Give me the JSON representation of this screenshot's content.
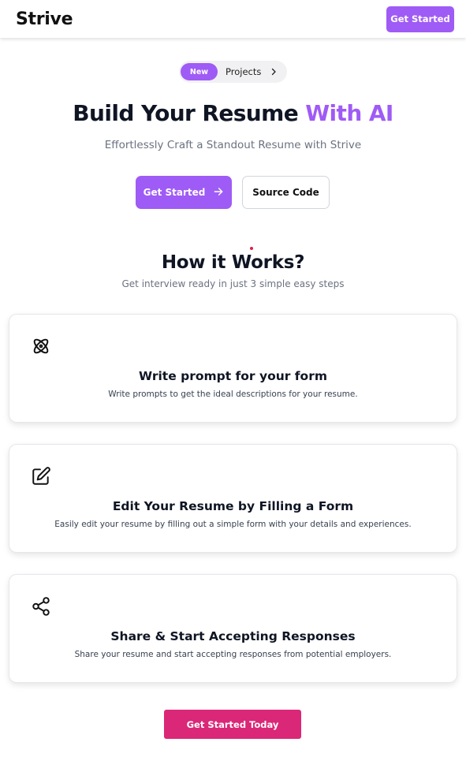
{
  "header": {
    "logo": "Strive",
    "cta_label": "Get Started"
  },
  "announcement": {
    "badge": "New",
    "label": "Projects",
    "icon": "chevron-right-icon"
  },
  "hero": {
    "title_main": "Build Your Resume",
    "title_accent": "With AI",
    "subtitle": "Effortlessly Craft a Standout Resume with Strive",
    "primary_label": "Get Started",
    "primary_icon": "arrow-right-icon",
    "secondary_label": "Source Code"
  },
  "how": {
    "title": "How it Works?",
    "subtitle": "Get interview ready in just 3 simple easy steps",
    "steps": [
      {
        "icon": "atom-icon",
        "title": "Write prompt for your form",
        "description": "Write prompts to get the ideal descriptions for your resume."
      },
      {
        "icon": "edit-icon",
        "title": "Edit Your Resume by Filling a Form",
        "description": "Easily edit your resume by filling out a simple form with your details and experiences."
      },
      {
        "icon": "share-icon",
        "title": "Share & Start Accepting Responses",
        "description": "Share your resume and start accepting responses from potential employers."
      }
    ]
  },
  "footer_cta": {
    "label": "Get Started Today"
  },
  "colors": {
    "accent": "#9f5bf5",
    "cta_pink": "#db2777",
    "text_dark": "#0f1523",
    "muted": "#6b7280"
  }
}
